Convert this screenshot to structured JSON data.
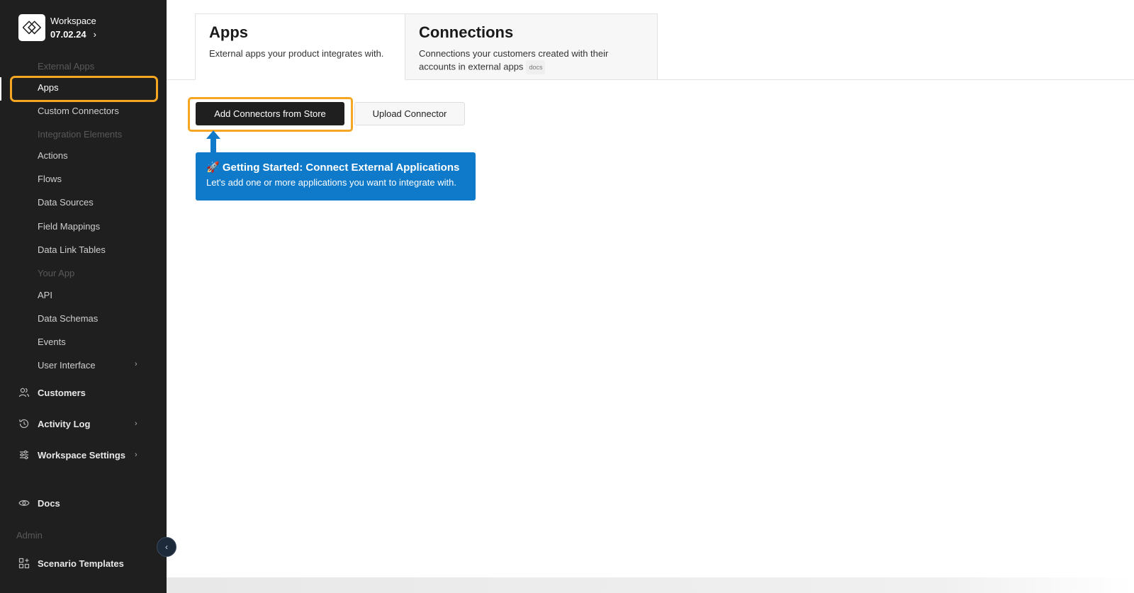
{
  "workspace": {
    "name": "Workspace",
    "version": "07.02.24"
  },
  "sidebar": {
    "sections": [
      "External Apps",
      "Integration Elements",
      "Your App",
      "Admin"
    ],
    "items": [
      {
        "label": "Apps"
      },
      {
        "label": "Custom Connectors"
      },
      {
        "label": "Actions"
      },
      {
        "label": "Flows"
      },
      {
        "label": "Data Sources"
      },
      {
        "label": "Field Mappings"
      },
      {
        "label": "Data Link Tables"
      },
      {
        "label": "API"
      },
      {
        "label": "Data Schemas"
      },
      {
        "label": "Events"
      },
      {
        "label": "User Interface"
      }
    ],
    "main_items": [
      {
        "label": "Customers"
      },
      {
        "label": "Activity Log"
      },
      {
        "label": "Workspace Settings"
      },
      {
        "label": "Docs"
      },
      {
        "label": "Scenario Templates"
      }
    ]
  },
  "tabs": [
    {
      "title": "Apps",
      "description": "External apps your product integrates with."
    },
    {
      "title": "Connections",
      "description": "Connections your customers created with their accounts in external apps",
      "badge": "docs"
    }
  ],
  "actions": {
    "primary": "Add Connectors from Store",
    "secondary": "Upload Connector"
  },
  "tooltip": {
    "emoji": "🚀",
    "title": "Getting Started: Connect External Applications",
    "body": "Let's add one or more applications you want to integrate with."
  },
  "colors": {
    "sidebar_bg": "#1f1f1f",
    "highlight": "#f5a623",
    "tooltip_bg": "#0f7ac9"
  }
}
